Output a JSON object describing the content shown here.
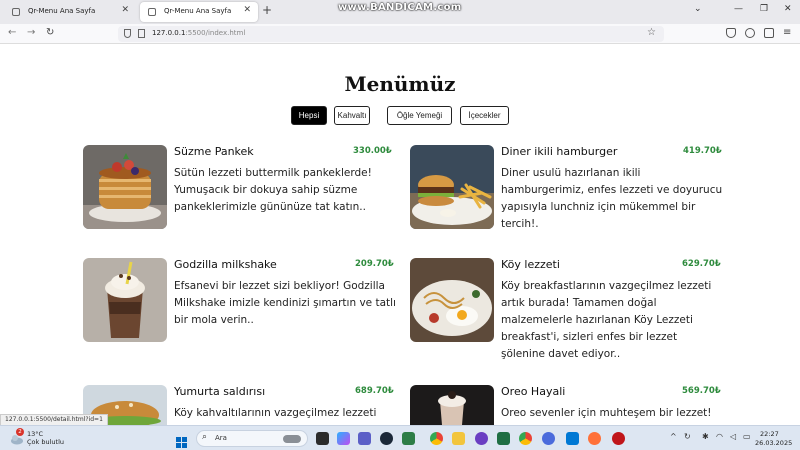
{
  "browser": {
    "tabs": [
      {
        "title": "Qr-Menu Ana Sayfa",
        "active": false
      },
      {
        "title": "Qr-Menu Ana Sayfa",
        "active": true
      }
    ],
    "url_host": "127.0.0.1",
    "url_rest": ":5500/index.html",
    "watermark": "www.BANDICAM.com",
    "status_url": "127.0.0.1:5500/detail.html?id=1"
  },
  "menu": {
    "title": "Menümüz",
    "filters": [
      {
        "label": "Hepsi",
        "active": true
      },
      {
        "label": "Kahvaltı",
        "active": false
      },
      {
        "label": "Öğle Yemeği",
        "active": false
      },
      {
        "label": "İçecekler",
        "active": false
      }
    ],
    "items": [
      {
        "name": "Süzme Pankek",
        "price": "330.00₺",
        "desc": "Sütün lezzeti buttermilk pankeklerde! Yumuşacık bir dokuya sahip süzme pankeklerimizle gününüze tat katın..",
        "image": "pancake-photo"
      },
      {
        "name": "Diner ikili hamburger",
        "price": "419.70₺",
        "desc": "Diner usulü hazırlanan ikili hamburgerimiz, enfes lezzeti ve doyurucu yapısıyla lunchniz için mükemmel bir tercih!.",
        "image": "burger-photo"
      },
      {
        "name": "Godzilla milkshake",
        "price": "209.70₺",
        "desc": "Efsanevi bir lezzet sizi bekliyor! Godzilla Milkshake imizle kendinizi şımartın ve tatlı bir mola verin..",
        "image": "milkshake-photo"
      },
      {
        "name": "Köy lezzeti",
        "price": "629.70₺",
        "desc": "Köy breakfastlarının vazgeçilmez lezzeti artık burada! Tamamen doğal malzemelerle hazırlanan Köy Lezzeti breakfast'i, sizleri enfes bir lezzet şölenine davet ediyor..",
        "image": "breakfast-photo"
      },
      {
        "name": "Yumurta saldırısı",
        "price": "689.70₺",
        "desc": "Köy kahvaltılarının vazgeçilmez lezzeti",
        "image": "egg-burger-photo"
      },
      {
        "name": "Oreo Hayali",
        "price": "569.70₺",
        "desc": "Oreo sevenler için muhteşem bir lezzet!",
        "image": "oreo-shake-photo"
      }
    ]
  },
  "taskbar": {
    "weather_temp": "13°C",
    "weather_desc": "Çok bulutlu",
    "weather_badge": "2",
    "search_label": "Ara",
    "time": "22:27",
    "date": "26.03.2025",
    "accent": "#0067c0"
  }
}
